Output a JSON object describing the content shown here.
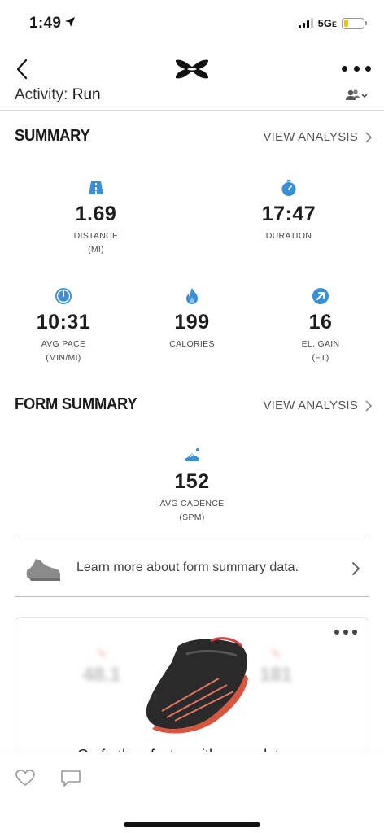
{
  "status": {
    "time": "1:49",
    "network": "5G",
    "network_suffix": "E",
    "battery_level": 0.22
  },
  "nav": {
    "logo": "under-armour-logo"
  },
  "activity": {
    "prefix": "Activity:",
    "type": "Run"
  },
  "summary": {
    "title": "SUMMARY",
    "view_link": "VIEW ANALYSIS",
    "distance": {
      "value": "1.69",
      "label": "DISTANCE",
      "unit": "(MI)",
      "icon": "road-icon"
    },
    "duration": {
      "value": "17:47",
      "label": "DURATION",
      "icon": "stopwatch-icon"
    },
    "pace": {
      "value": "10:31",
      "label": "AVG PACE",
      "unit": "(MIN/MI)",
      "icon": "gauge-icon"
    },
    "calories": {
      "value": "199",
      "label": "CALORIES",
      "icon": "flame-icon"
    },
    "elevation": {
      "value": "16",
      "label": "EL. GAIN",
      "unit": "(FT)",
      "icon": "arrow-up-right-icon"
    }
  },
  "form_summary": {
    "title": "FORM SUMMARY",
    "view_link": "VIEW ANALYSIS",
    "cadence": {
      "value": "152",
      "label": "AVG CADENCE",
      "unit": "(SPM)",
      "icon": "running-shoe-icon"
    },
    "learn_more": "Learn more about form summary data."
  },
  "promo": {
    "left_value": "48.1",
    "right_value": "181",
    "text": "Go further, faster with more data"
  },
  "colors": {
    "accent": "#3a8fd6",
    "text": "#1d1d1f",
    "muted": "#4a4a4a"
  }
}
